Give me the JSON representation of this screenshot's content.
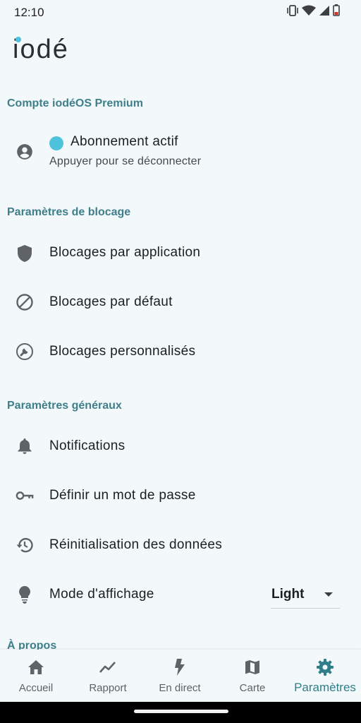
{
  "status": {
    "time": "12:10",
    "icons": [
      "vibrate-icon",
      "wifi-icon",
      "signal-icon",
      "battery-low-icon"
    ]
  },
  "brand": {
    "name": "iodé"
  },
  "account": {
    "section_title": "Compte iodéOS Premium",
    "status_title": "Abonnement actif",
    "status_subtitle": "Appuyer pour se déconnecter",
    "status_color": "#4fc3dc"
  },
  "blocking": {
    "section_title": "Paramètres de blocage",
    "items": [
      {
        "label": "Blocages par application",
        "icon": "shield-icon"
      },
      {
        "label": "Blocages par défaut",
        "icon": "block-icon"
      },
      {
        "label": "Blocages personnalisés",
        "icon": "wrench-icon"
      }
    ]
  },
  "general": {
    "section_title": "Paramètres généraux",
    "items": [
      {
        "label": "Notifications",
        "icon": "bell-icon"
      },
      {
        "label": "Définir un mot de passe",
        "icon": "key-icon"
      },
      {
        "label": "Réinitialisation des données",
        "icon": "history-icon"
      },
      {
        "label": "Mode d'affichage",
        "icon": "lightbulb-icon"
      }
    ],
    "display_mode_value": "Light"
  },
  "about": {
    "section_title": "À propos"
  },
  "nav": {
    "items": [
      {
        "label": "Accueil",
        "icon": "home-icon"
      },
      {
        "label": "Rapport",
        "icon": "chart-line-icon"
      },
      {
        "label": "En direct",
        "icon": "lightning-icon"
      },
      {
        "label": "Carte",
        "icon": "map-icon"
      },
      {
        "label": "Paramètres",
        "icon": "gear-icon",
        "active": true
      }
    ]
  },
  "colors": {
    "accent": "#3e7f8a",
    "background": "#f3f8fb",
    "active_nav": "#2f7f8a"
  }
}
